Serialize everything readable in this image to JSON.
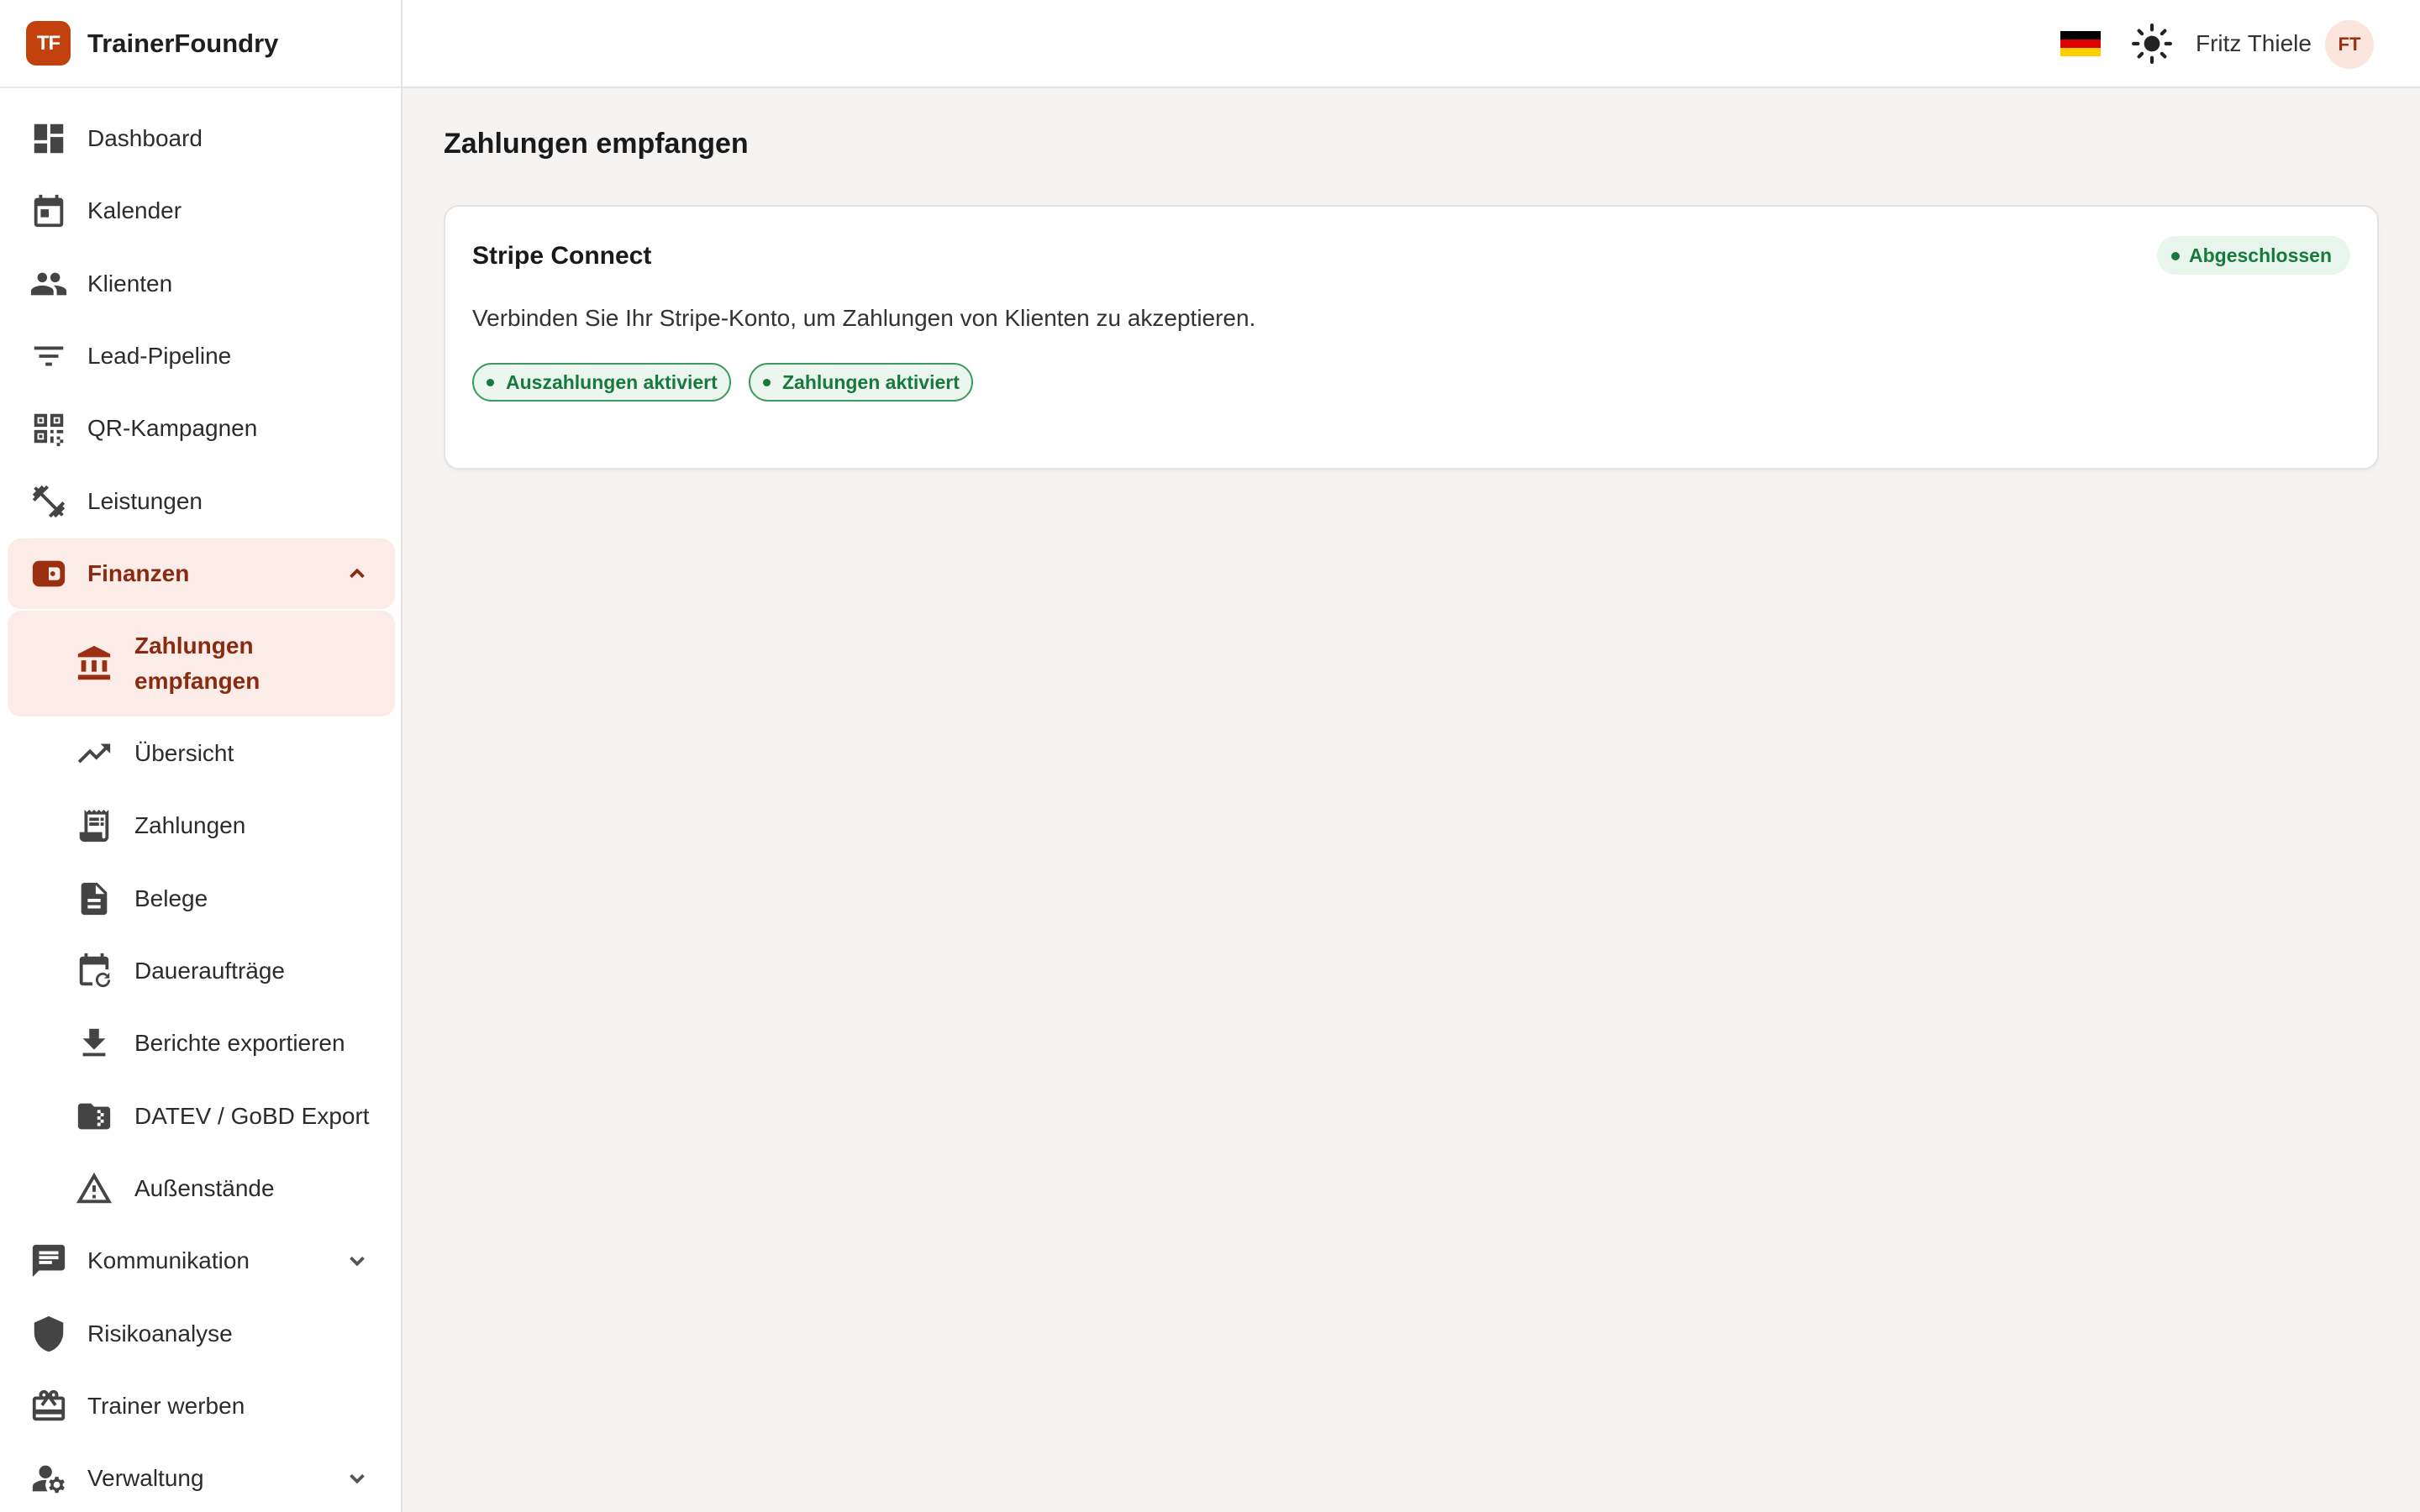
{
  "app": {
    "logo_text": "TF",
    "name": "TrainerFoundry"
  },
  "header": {
    "language_flag": "de-flag-icon",
    "theme_icon": "sun-icon",
    "user_name": "Fritz Thiele",
    "user_initials": "FT"
  },
  "sidebar": {
    "items": [
      {
        "label": "Dashboard",
        "icon": "dashboard-icon"
      },
      {
        "label": "Kalender",
        "icon": "calendar-icon"
      },
      {
        "label": "Klienten",
        "icon": "people-icon"
      },
      {
        "label": "Lead-Pipeline",
        "icon": "filter-icon"
      },
      {
        "label": "QR-Kampagnen",
        "icon": "qr-code-icon"
      },
      {
        "label": "Leistungen",
        "icon": "dumbbell-icon"
      },
      {
        "label": "Finanzen",
        "icon": "wallet-icon",
        "expanded": true
      },
      {
        "label": "Kommunikation",
        "icon": "chat-icon"
      },
      {
        "label": "Risikoanalyse",
        "icon": "shield-icon"
      },
      {
        "label": "Trainer werben",
        "icon": "gift-icon"
      },
      {
        "label": "Verwaltung",
        "icon": "user-settings-icon"
      }
    ],
    "finance_sub": [
      {
        "label": "Zahlungen empfangen",
        "icon": "bank-icon",
        "active": true
      },
      {
        "label": "Übersicht",
        "icon": "trending-up-icon"
      },
      {
        "label": "Zahlungen",
        "icon": "receipt-icon"
      },
      {
        "label": "Belege",
        "icon": "document-icon"
      },
      {
        "label": "Daueraufträge",
        "icon": "calendar-repeat-icon"
      },
      {
        "label": "Berichte exportieren",
        "icon": "download-icon"
      },
      {
        "label": "DATEV / GoBD Export",
        "icon": "folder-zip-icon"
      },
      {
        "label": "Außenstände",
        "icon": "warning-icon"
      }
    ]
  },
  "main": {
    "title": "Zahlungen empfangen",
    "card": {
      "title": "Stripe Connect",
      "status": "Abgeschlossen",
      "description": "Verbinden Sie Ihr Stripe-Konto, um Zahlungen von Klienten zu akzeptieren.",
      "badges": [
        "Auszahlungen aktiviert",
        "Zahlungen aktiviert"
      ]
    }
  },
  "colors": {
    "brand": "#c2410c",
    "active_bg": "#fbece7",
    "success": "#177a3c"
  }
}
